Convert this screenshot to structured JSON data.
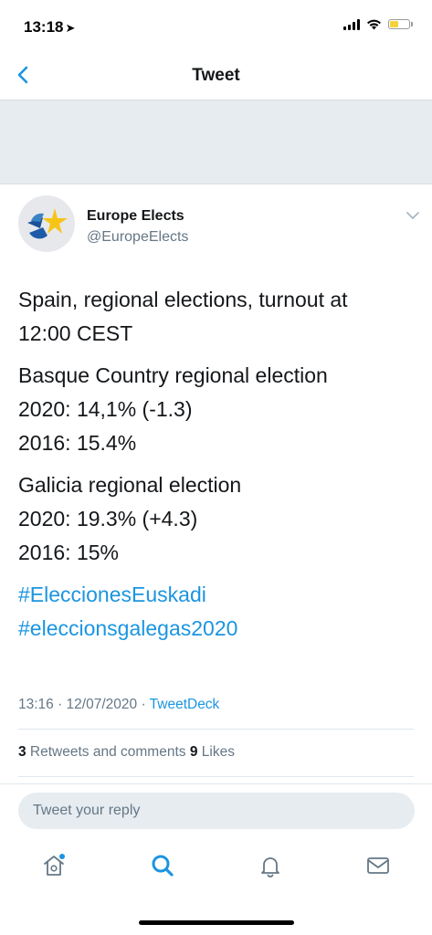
{
  "status": {
    "time": "13:18",
    "location_glyph": "➤"
  },
  "nav": {
    "title": "Tweet"
  },
  "tweet": {
    "author_name": "Europe Elects",
    "author_handle": "@EuropeElects",
    "paragraphs": [
      [
        "Spain, regional elections, turnout at",
        "12:00 CEST"
      ],
      [
        "Basque Country regional election",
        "2020: 14,1% (-1.3)",
        "2016: 15.4%"
      ],
      [
        "Galicia regional election",
        "2020: 19.3% (+4.3)",
        "2016: 15%"
      ]
    ],
    "hashtags": [
      "#EleccionesEuskadi",
      "#eleccionsgalegas2020"
    ],
    "timestamp": "13:16 · 12/07/2020 · ",
    "source": "TweetDeck",
    "retweets_count": "3",
    "retweets_label": " Retweets and comments ",
    "likes_count": "9",
    "likes_label": " Likes"
  },
  "reply": {
    "placeholder": "Tweet your reply"
  },
  "colors": {
    "accent": "#1b95e0",
    "secondary_text": "#657786",
    "band": "#e6ecf0"
  },
  "icons": {
    "back": "chevron-left-icon",
    "more": "chevron-down-icon",
    "home": "home-icon",
    "search": "search-icon",
    "notifications": "bell-icon",
    "messages": "envelope-icon"
  }
}
